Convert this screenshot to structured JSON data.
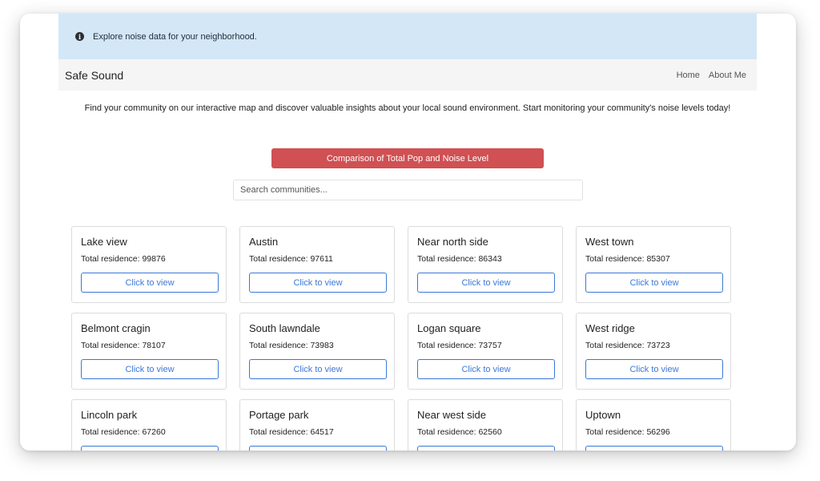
{
  "alert": {
    "icon": "info-icon",
    "text": "Explore noise data for your neighborhood."
  },
  "navbar": {
    "brand": "Safe Sound",
    "links": [
      {
        "label": "Home"
      },
      {
        "label": "About Me"
      }
    ]
  },
  "intro": "Find your community on our interactive map and discover valuable insights about your local sound environment. Start monitoring your community's noise levels today!",
  "compare_button": "Comparison of Total Pop and Noise Level",
  "search": {
    "placeholder": "Search communities...",
    "value": ""
  },
  "card_button_label": "Click to view",
  "colors": {
    "alert_bg": "#d4e7f7",
    "compare_button_bg": "#d05053",
    "link_blue": "#3b78d8"
  },
  "communities": [
    {
      "name": "Lake view",
      "residence": "Total residence: 99876"
    },
    {
      "name": "Austin",
      "residence": "Total residence: 97611"
    },
    {
      "name": "Near north side",
      "residence": "Total residence: 86343"
    },
    {
      "name": "West town",
      "residence": "Total residence: 85307"
    },
    {
      "name": "Belmont cragin",
      "residence": "Total residence: 78107"
    },
    {
      "name": "South lawndale",
      "residence": "Total residence: 73983"
    },
    {
      "name": "Logan square",
      "residence": "Total residence: 73757"
    },
    {
      "name": "West ridge",
      "residence": "Total residence: 73723"
    },
    {
      "name": "Lincoln park",
      "residence": "Total residence: 67260"
    },
    {
      "name": "Portage park",
      "residence": "Total residence: 64517"
    },
    {
      "name": "Near west side",
      "residence": "Total residence: 62560"
    },
    {
      "name": "Uptown",
      "residence": "Total residence: 56296"
    }
  ]
}
